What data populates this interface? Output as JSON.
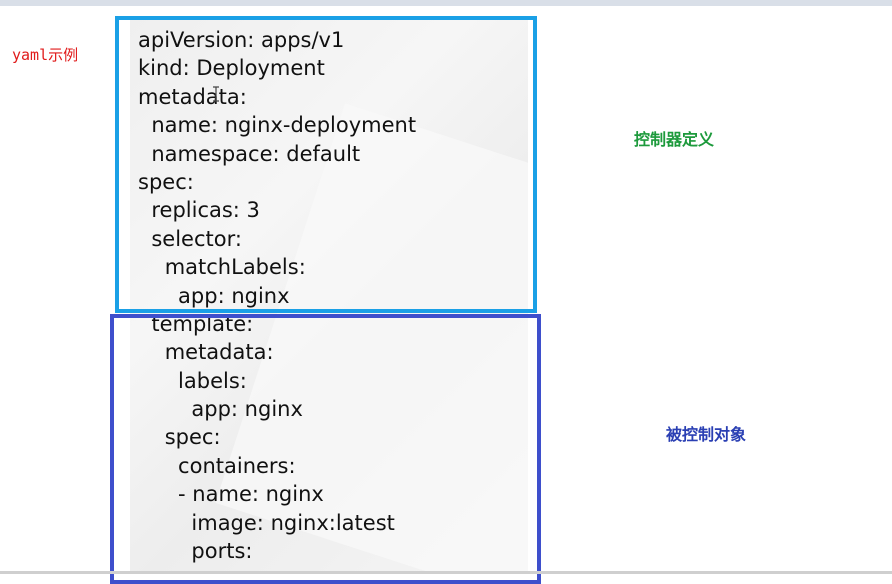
{
  "labels": {
    "yaml_example": "yaml示例",
    "controller_definition": "控制器定义",
    "controlled_object": "被控制对象"
  },
  "code_lines": [
    "apiVersion: apps/v1",
    "kind: Deployment",
    "metadata:",
    "  name: nginx-deployment",
    "  namespace: default",
    "spec:",
    "  replicas: 3",
    "  selector:",
    "    matchLabels:",
    "      app: nginx",
    "  template:",
    "    metadata:",
    "      labels:",
    "        app: nginx",
    "    spec:",
    "      containers:",
    "      - name: nginx",
    "        image: nginx:latest",
    "        ports:"
  ],
  "colors": {
    "controller_box": "#1aa0e6",
    "target_box": "#3e4fcc",
    "yaml_label": "#e01a1a",
    "controller_label": "#1d9a3c",
    "target_label": "#2a3fb3"
  },
  "icons": {
    "cursor": "text-cursor-icon"
  }
}
